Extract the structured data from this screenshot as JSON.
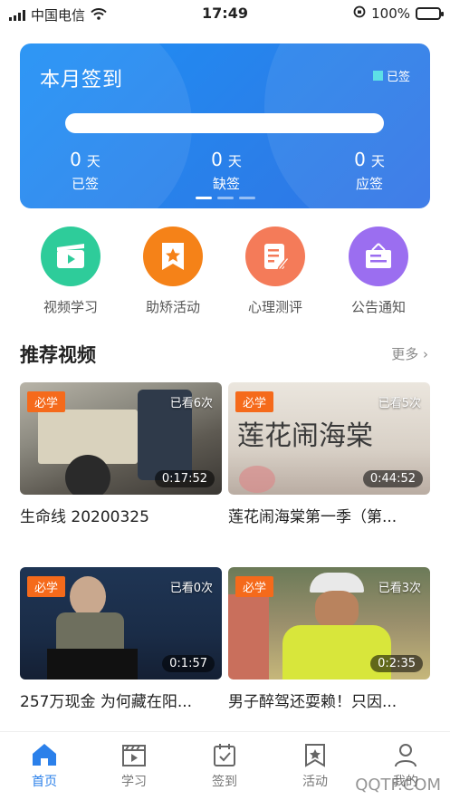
{
  "status_bar": {
    "carrier": "中国电信",
    "time": "17:49",
    "battery": "100%"
  },
  "sign_card": {
    "title": "本月签到",
    "legend": "已签",
    "stats": [
      {
        "value": "0",
        "unit": "天",
        "label": "已签"
      },
      {
        "value": "0",
        "unit": "天",
        "label": "缺签"
      },
      {
        "value": "0",
        "unit": "天",
        "label": "应签"
      }
    ]
  },
  "actions": [
    {
      "label": "视频学习",
      "color": "#2ecc9a",
      "icon": "video-icon"
    },
    {
      "label": "助矫活动",
      "color": "#f58218",
      "icon": "star-bookmark-icon"
    },
    {
      "label": "心理测评",
      "color": "#f47b59",
      "icon": "form-edit-icon"
    },
    {
      "label": "公告通知",
      "color": "#9b6ef0",
      "icon": "notice-board-icon"
    }
  ],
  "section": {
    "title": "推荐视频",
    "more": "更多"
  },
  "videos": [
    {
      "badge": "必学",
      "views": "已看6次",
      "duration": "0:17:52",
      "title": "生命线 20200325"
    },
    {
      "badge": "必学",
      "views": "已看5次",
      "duration": "0:44:52",
      "title": "莲花闹海棠第一季（第..."
    },
    {
      "badge": "必学",
      "views": "已看0次",
      "duration": "0:1:57",
      "title": "257万现金 为何藏在阳..."
    },
    {
      "badge": "必学",
      "views": "已看3次",
      "duration": "0:2:35",
      "title": "男子醉驾还耍赖！只因..."
    }
  ],
  "tabs": [
    {
      "label": "首页",
      "icon": "home-icon",
      "active": true
    },
    {
      "label": "学习",
      "icon": "clapperboard-icon",
      "active": false
    },
    {
      "label": "签到",
      "icon": "calendar-check-icon",
      "active": false
    },
    {
      "label": "活动",
      "icon": "star-bookmark-icon",
      "active": false
    },
    {
      "label": "我的",
      "icon": "user-icon",
      "active": false
    }
  ],
  "watermark": "QQTF.COM",
  "colors": {
    "accent": "#2b80ea",
    "badge": "#f56a1b",
    "card_gradient_start": "#1d8ff5",
    "card_gradient_end": "#3173e6"
  }
}
